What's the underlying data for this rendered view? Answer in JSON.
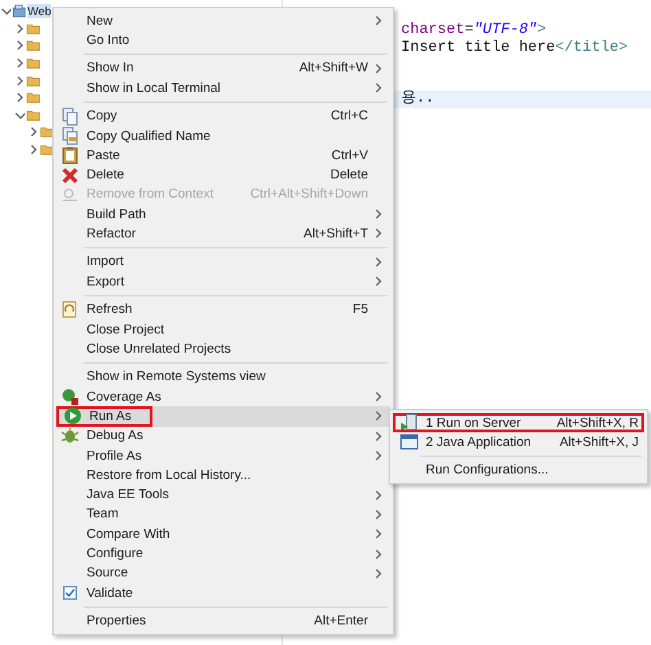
{
  "project_tree": {
    "root": {
      "label": "Web",
      "selected": true,
      "expanded": true,
      "children": [
        {
          "expanded": false,
          "selected": false
        },
        {
          "expanded": false,
          "selected": false
        },
        {
          "expanded": false,
          "selected": false
        },
        {
          "expanded": false,
          "selected": false
        },
        {
          "expanded": false,
          "selected": false
        },
        {
          "expanded": true,
          "selected": false,
          "children": [
            {
              "expanded": false,
              "selected": false
            },
            {
              "expanded": false,
              "selected": false
            }
          ]
        }
      ]
    }
  },
  "editor": {
    "lines": [
      {
        "current": false,
        "segments": [
          {
            "kind": "attribute",
            "text": "charset"
          },
          {
            "kind": "plain",
            "text": "="
          },
          {
            "kind": "string",
            "text": "\"UTF-8\""
          },
          {
            "kind": "tag",
            "text": ">"
          }
        ]
      },
      {
        "current": false,
        "segments": [
          {
            "kind": "plain",
            "text": "Insert title here"
          },
          {
            "kind": "tag",
            "text": "</title>"
          }
        ]
      },
      {
        "current": false
      },
      {
        "current": false
      },
      {
        "current": true,
        "segments": [
          {
            "kind": "plain",
            "text": "용.."
          }
        ]
      }
    ]
  },
  "context_menu": {
    "items": [
      {
        "kind": "item",
        "label": "New",
        "has_submenu": true,
        "disabled": false,
        "highlighted": false,
        "annotated": false
      },
      {
        "kind": "item",
        "label": "Go Into",
        "has_submenu": false,
        "disabled": false,
        "highlighted": false,
        "annotated": false
      },
      {
        "kind": "separator"
      },
      {
        "kind": "item",
        "label": "Show In",
        "shortcut": "Alt+Shift+W",
        "has_submenu": true,
        "disabled": false,
        "highlighted": false,
        "annotated": false
      },
      {
        "kind": "item",
        "label": "Show in Local Terminal",
        "has_submenu": true,
        "disabled": false,
        "highlighted": false,
        "annotated": false
      },
      {
        "kind": "separator"
      },
      {
        "kind": "item",
        "label": "Copy",
        "shortcut": "Ctrl+C",
        "has_submenu": false,
        "disabled": false,
        "highlighted": false,
        "annotated": false
      },
      {
        "kind": "item",
        "label": "Copy Qualified Name",
        "has_submenu": false,
        "disabled": false,
        "highlighted": false,
        "annotated": false
      },
      {
        "kind": "item",
        "label": "Paste",
        "shortcut": "Ctrl+V",
        "has_submenu": false,
        "disabled": false,
        "highlighted": false,
        "annotated": false
      },
      {
        "kind": "item",
        "label": "Delete",
        "shortcut": "Delete",
        "has_submenu": false,
        "disabled": false,
        "highlighted": false,
        "annotated": false
      },
      {
        "kind": "item",
        "label": "Remove from Context",
        "shortcut": "Ctrl+Alt+Shift+Down",
        "has_submenu": false,
        "disabled": true,
        "highlighted": false,
        "annotated": false
      },
      {
        "kind": "item",
        "label": "Build Path",
        "has_submenu": true,
        "disabled": false,
        "highlighted": false,
        "annotated": false
      },
      {
        "kind": "item",
        "label": "Refactor",
        "shortcut": "Alt+Shift+T",
        "has_submenu": true,
        "disabled": false,
        "highlighted": false,
        "annotated": false
      },
      {
        "kind": "separator"
      },
      {
        "kind": "item",
        "label": "Import",
        "has_submenu": true,
        "disabled": false,
        "highlighted": false,
        "annotated": false
      },
      {
        "kind": "item",
        "label": "Export",
        "has_submenu": true,
        "disabled": false,
        "highlighted": false,
        "annotated": false
      },
      {
        "kind": "separator"
      },
      {
        "kind": "item",
        "label": "Refresh",
        "shortcut": "F5",
        "has_submenu": false,
        "disabled": false,
        "highlighted": false,
        "annotated": false
      },
      {
        "kind": "item",
        "label": "Close Project",
        "has_submenu": false,
        "disabled": false,
        "highlighted": false,
        "annotated": false
      },
      {
        "kind": "item",
        "label": "Close Unrelated Projects",
        "has_submenu": false,
        "disabled": false,
        "highlighted": false,
        "annotated": false
      },
      {
        "kind": "separator"
      },
      {
        "kind": "item",
        "label": "Show in Remote Systems view",
        "has_submenu": false,
        "disabled": false,
        "highlighted": false,
        "annotated": false
      },
      {
        "kind": "item",
        "label": "Coverage As",
        "has_submenu": true,
        "disabled": false,
        "highlighted": false,
        "annotated": false
      },
      {
        "kind": "item",
        "label": "Run As",
        "has_submenu": true,
        "disabled": false,
        "highlighted": true,
        "annotated": true
      },
      {
        "kind": "item",
        "label": "Debug As",
        "has_submenu": true,
        "disabled": false,
        "highlighted": false,
        "annotated": false
      },
      {
        "kind": "item",
        "label": "Profile As",
        "has_submenu": true,
        "disabled": false,
        "highlighted": false,
        "annotated": false
      },
      {
        "kind": "item",
        "label": "Restore from Local History...",
        "has_submenu": false,
        "disabled": false,
        "highlighted": false,
        "annotated": false
      },
      {
        "kind": "item",
        "label": "Java EE Tools",
        "has_submenu": true,
        "disabled": false,
        "highlighted": false,
        "annotated": false
      },
      {
        "kind": "item",
        "label": "Team",
        "has_submenu": true,
        "disabled": false,
        "highlighted": false,
        "annotated": false
      },
      {
        "kind": "item",
        "label": "Compare With",
        "has_submenu": true,
        "disabled": false,
        "highlighted": false,
        "annotated": false
      },
      {
        "kind": "item",
        "label": "Configure",
        "has_submenu": true,
        "disabled": false,
        "highlighted": false,
        "annotated": false
      },
      {
        "kind": "item",
        "label": "Source",
        "has_submenu": true,
        "disabled": false,
        "highlighted": false,
        "annotated": false
      },
      {
        "kind": "check",
        "label": "Validate",
        "checked": true,
        "has_submenu": false,
        "disabled": false,
        "highlighted": false,
        "annotated": false
      },
      {
        "kind": "separator"
      },
      {
        "kind": "item",
        "label": "Properties",
        "shortcut": "Alt+Enter",
        "has_submenu": false,
        "disabled": false,
        "highlighted": false,
        "annotated": false
      }
    ]
  },
  "run_as_submenu": {
    "items": [
      {
        "kind": "item",
        "label": "1 Run on Server",
        "shortcut": "Alt+Shift+X, R",
        "has_submenu": false,
        "disabled": false,
        "highlighted": false,
        "annotated": true
      },
      {
        "kind": "item",
        "label": "2 Java Application",
        "shortcut": "Alt+Shift+X, J",
        "has_submenu": false,
        "disabled": false,
        "highlighted": false,
        "annotated": false
      },
      {
        "kind": "separator"
      },
      {
        "kind": "item",
        "label": "Run Configurations...",
        "has_submenu": false,
        "disabled": false,
        "highlighted": false,
        "annotated": false
      }
    ]
  }
}
